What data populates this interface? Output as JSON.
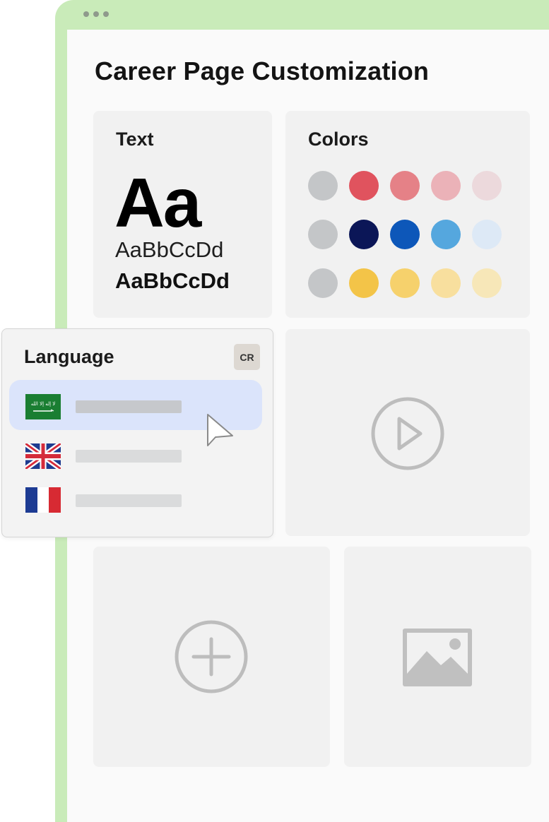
{
  "window": {
    "title": "Career Page Customization"
  },
  "text_card": {
    "title": "Text",
    "sample_large": "Aa",
    "sample_regular": "AaBbCcDd",
    "sample_bold": "AaBbCcDd"
  },
  "colors_card": {
    "title": "Colors",
    "rows": [
      [
        "#c4c6c8",
        "#e0535e",
        "#e58187",
        "#ebb2b8",
        "#ecd9dc"
      ],
      [
        "#c4c6c8",
        "#0b1657",
        "#0d57b9",
        "#55a7de",
        "#dde9f6"
      ],
      [
        "#c4c6c8",
        "#f3c448",
        "#f6d16c",
        "#f8df9e",
        "#f7e7b8"
      ]
    ]
  },
  "language_panel": {
    "title": "Language",
    "badge": "CR",
    "flag_ar_text": "لا إله إلا الله",
    "items": [
      {
        "flag": "saudi-arabia-flag-icon",
        "selected": true
      },
      {
        "flag": "uk-flag-icon",
        "selected": false
      },
      {
        "flag": "france-flag-icon",
        "selected": false
      }
    ]
  },
  "icons": {
    "video": "play-circle-icon",
    "add": "plus-circle-icon",
    "image": "image-icon",
    "cursor": "mouse-pointer-icon"
  }
}
